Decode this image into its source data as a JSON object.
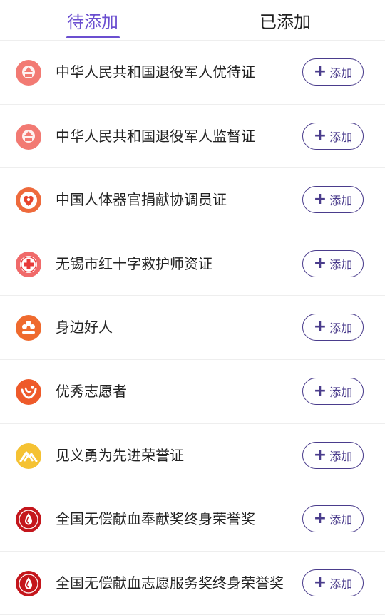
{
  "tabs": [
    {
      "label": "待添加",
      "active": true
    },
    {
      "label": "已添加",
      "active": false
    }
  ],
  "accent_color": "#6b4fd0",
  "items": [
    {
      "title": "中华人民共和国退役军人优待证",
      "icon": "national-emblem-icon",
      "button_label": "添加",
      "button_icon": "+"
    },
    {
      "title": "中华人民共和国退役军人监督证",
      "icon": "national-emblem-icon",
      "button_label": "添加",
      "button_icon": "+"
    },
    {
      "title": "中国人体器官捐献协调员证",
      "icon": "organ-donation-heart-icon",
      "button_label": "添加",
      "button_icon": "+"
    },
    {
      "title": "无锡市红十字救护师资证",
      "icon": "red-cross-icon",
      "button_label": "添加",
      "button_icon": "+"
    },
    {
      "title": "身边好人",
      "icon": "good-person-flower-icon",
      "button_label": "添加",
      "button_icon": "+"
    },
    {
      "title": "优秀志愿者",
      "icon": "volunteer-heart-icon",
      "button_label": "添加",
      "button_icon": "+"
    },
    {
      "title": "见义勇为先进荣誉证",
      "icon": "bravery-mountain-icon",
      "button_label": "添加",
      "button_icon": "+"
    },
    {
      "title": "全国无偿献血奉献奖终身荣誉奖",
      "icon": "blood-donation-icon",
      "button_label": "添加",
      "button_icon": "+"
    },
    {
      "title": "全国无偿献血志愿服务奖终身荣誉奖",
      "icon": "blood-donation-icon",
      "button_label": "添加",
      "button_icon": "+"
    }
  ]
}
